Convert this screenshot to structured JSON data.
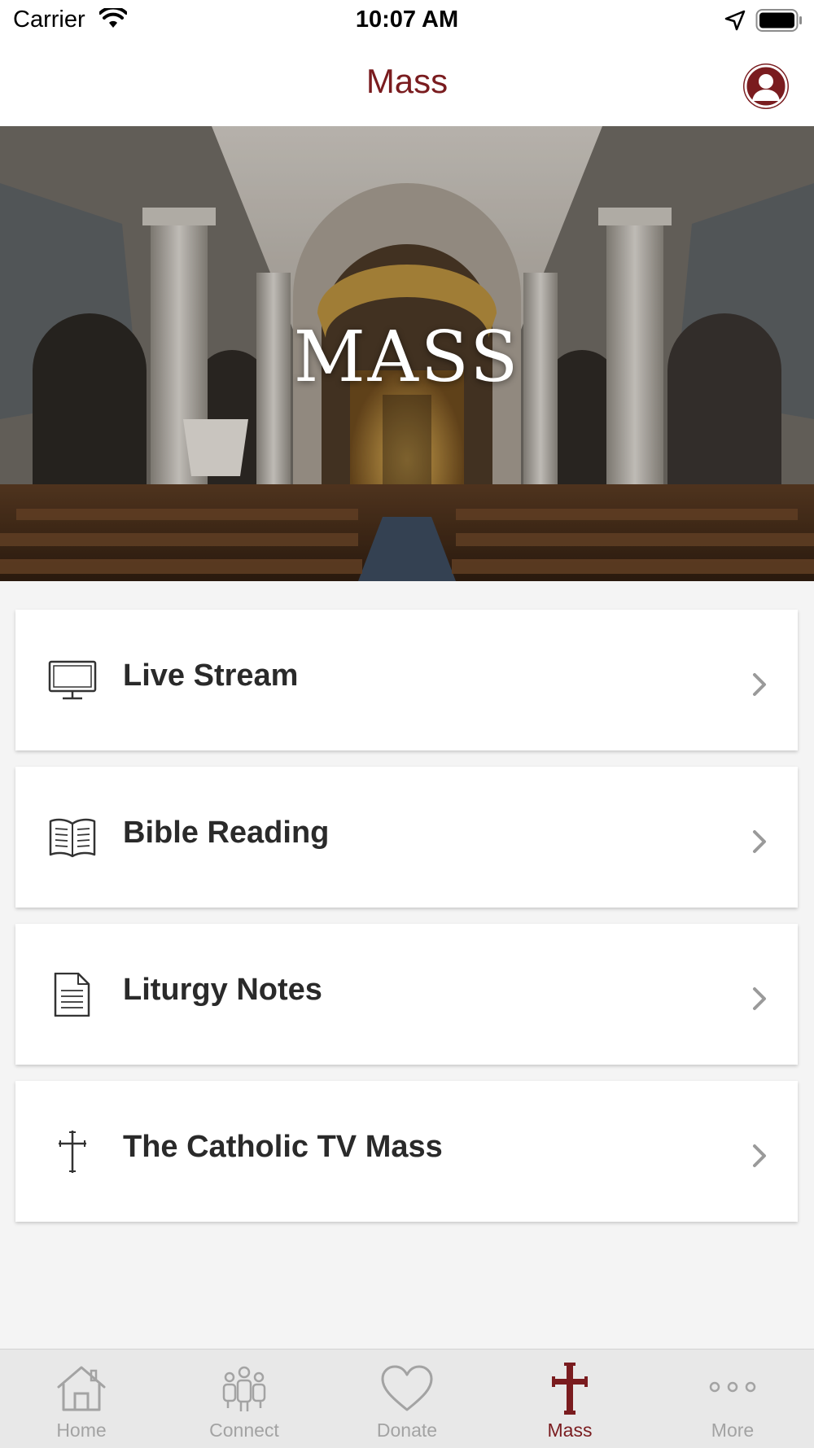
{
  "status_bar": {
    "carrier": "Carrier",
    "time": "10:07 AM"
  },
  "nav": {
    "title": "Mass"
  },
  "hero": {
    "title": "MASS"
  },
  "menu": {
    "items": [
      {
        "label": "Live Stream",
        "icon": "monitor-icon"
      },
      {
        "label": "Bible Reading",
        "icon": "open-book-icon"
      },
      {
        "label": "Liturgy Notes",
        "icon": "document-icon"
      },
      {
        "label": "The Catholic TV Mass",
        "icon": "cross-icon"
      }
    ]
  },
  "tabs": {
    "items": [
      {
        "label": "Home",
        "icon": "house-icon"
      },
      {
        "label": "Connect",
        "icon": "people-icon"
      },
      {
        "label": "Donate",
        "icon": "heart-icon"
      },
      {
        "label": "Mass",
        "icon": "cross-icon"
      },
      {
        "label": "More",
        "icon": "ellipsis-icon"
      }
    ],
    "active": "Mass"
  },
  "colors": {
    "accent": "#7a1c1f",
    "tab_inactive": "#a3a3a3",
    "background": "#f4f4f4"
  }
}
